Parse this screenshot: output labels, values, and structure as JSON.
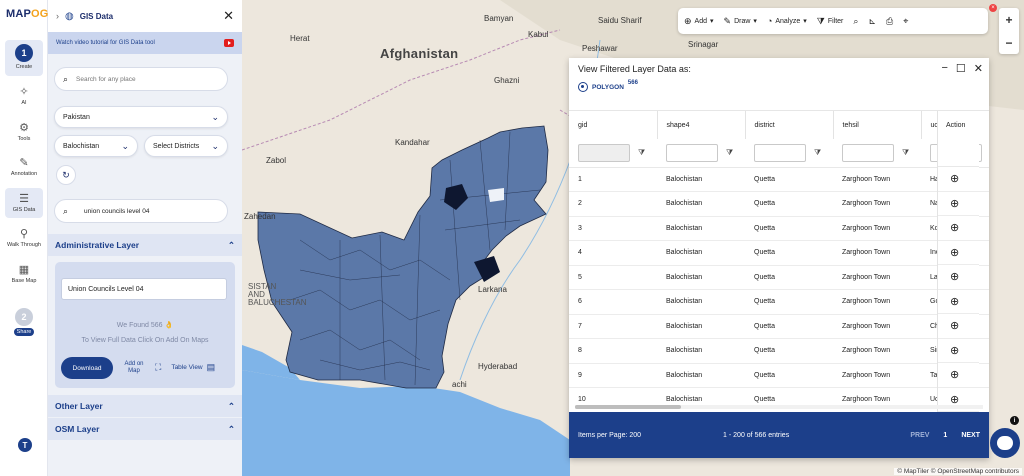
{
  "app": {
    "logo_prefix": "MAP",
    "logo_suffix": "OG"
  },
  "rail": {
    "items": [
      {
        "label": "Create",
        "step": "1"
      },
      {
        "label": "AI"
      },
      {
        "label": "Tools"
      },
      {
        "label": "Annotation"
      },
      {
        "label": "GIS Data"
      },
      {
        "label": "Walk Through"
      },
      {
        "label": "Base Map"
      },
      {
        "label": "Share",
        "step": "2"
      }
    ],
    "help_label": "T"
  },
  "panel": {
    "title": "GIS Data",
    "tutorial": "Watch video tutorial for GIS Data tool",
    "search_placeholder": "Search for any place",
    "country": "Pakistan",
    "province": "Balochistan",
    "districts": "Select Districts",
    "layer_search": "union councils level 04",
    "admin_header": "Administrative Layer",
    "layer_name": "Union Councils Level 04",
    "found_text": "We Found  566",
    "hint": "To View Full Data Click On Add On Maps",
    "download": "Download",
    "add_on_map": "Add on Map",
    "table_view": "Table View",
    "other_layer": "Other Layer",
    "osm_layer": "OSM Layer"
  },
  "toolbar": {
    "add": "Add",
    "draw": "Draw",
    "analyze": "Analyze",
    "filter": "Filter"
  },
  "map_labels": {
    "afghanistan": "Afghanistan",
    "kandahar": "Kandahar",
    "zabol": "Zabol",
    "zahedan": "Zahedan",
    "sistan": "SISTAN",
    "and": "AND",
    "baluchestan": "BALUCHESTAN",
    "larkana": "Larkana",
    "hyderabad": "Hyderabad",
    "peshawar": "Peshawar",
    "srinagar": "Srinagar",
    "saidu": "Saidu Sharif",
    "bamyan": "Bamyan",
    "kabul": "Kabul",
    "ghazni": "Ghazni",
    "herat": "Herat",
    "chachi": "achi"
  },
  "table": {
    "title": "View Filtered Layer Data as:",
    "geometry": "POLYGON",
    "count": "566",
    "columns": [
      "gid",
      "shape4",
      "district",
      "tehsil",
      "uc",
      "Action"
    ],
    "rows": [
      {
        "gid": "1",
        "shape4": "Balochistan",
        "district": "Quetta",
        "tehsil": "Zarghoon Town",
        "uc": "Ha"
      },
      {
        "gid": "2",
        "shape4": "Balochistan",
        "district": "Quetta",
        "tehsil": "Zarghoon Town",
        "uc": "Na"
      },
      {
        "gid": "3",
        "shape4": "Balochistan",
        "district": "Quetta",
        "tehsil": "Zarghoon Town",
        "uc": "Ko"
      },
      {
        "gid": "4",
        "shape4": "Balochistan",
        "district": "Quetta",
        "tehsil": "Zarghoon Town",
        "uc": "Inc"
      },
      {
        "gid": "5",
        "shape4": "Balochistan",
        "district": "Quetta",
        "tehsil": "Zarghoon Town",
        "uc": "La"
      },
      {
        "gid": "6",
        "shape4": "Balochistan",
        "district": "Quetta",
        "tehsil": "Zarghoon Town",
        "uc": "Go"
      },
      {
        "gid": "7",
        "shape4": "Balochistan",
        "district": "Quetta",
        "tehsil": "Zarghoon Town",
        "uc": "Ch"
      },
      {
        "gid": "8",
        "shape4": "Balochistan",
        "district": "Quetta",
        "tehsil": "Zarghoon Town",
        "uc": "Sir"
      },
      {
        "gid": "9",
        "shape4": "Balochistan",
        "district": "Quetta",
        "tehsil": "Zarghoon Town",
        "uc": "Ta"
      },
      {
        "gid": "10",
        "shape4": "Balochistan",
        "district": "Quetta",
        "tehsil": "Zarghoon Town",
        "uc": "Uc"
      }
    ],
    "footer": {
      "per_page": "Items per Page: 200",
      "range": "1 - 200 of 566 entries",
      "prev": "PREV",
      "page": "1",
      "next": "NEXT"
    }
  },
  "attribution": "© MapTiler © OpenStreetMap contributors",
  "colors": {
    "brand": "#1c3f8a",
    "polygon_fill": "#5b78a8",
    "polygon_stroke": "#1f2a44",
    "sea": "#7fb4e8"
  }
}
